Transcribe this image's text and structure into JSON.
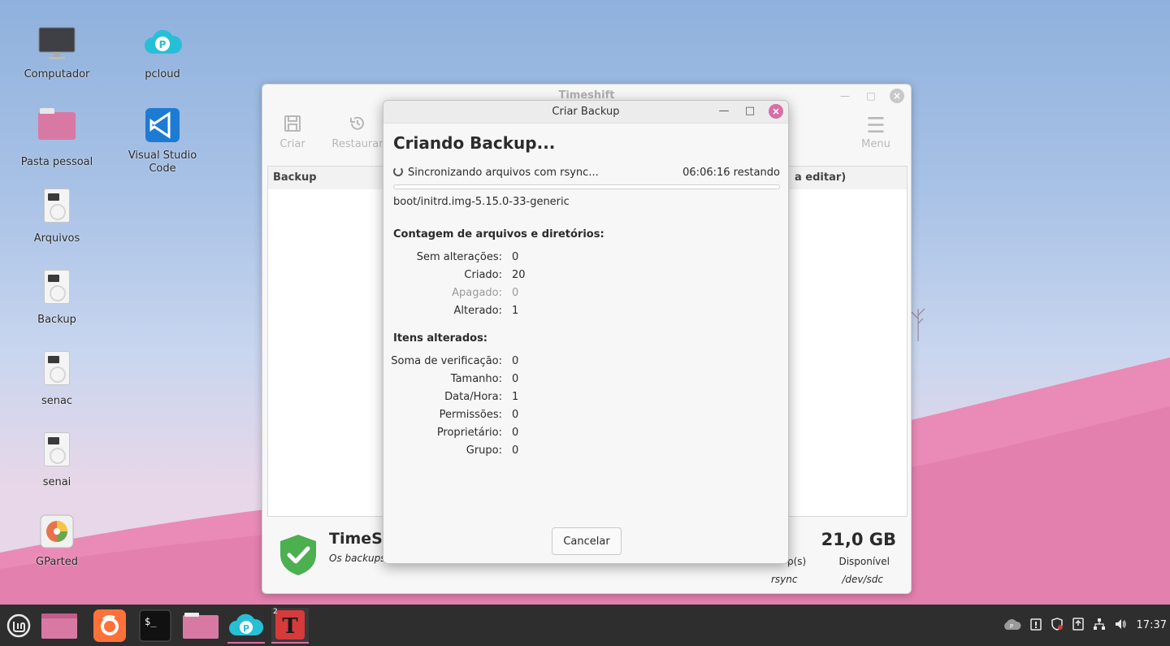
{
  "desktop": {
    "icons": [
      {
        "label": "Computador"
      },
      {
        "label": "pcloud"
      },
      {
        "label": "Pasta pessoal"
      },
      {
        "label": "Visual Studio Code"
      },
      {
        "label": "Arquivos"
      },
      {
        "label": "Backup"
      },
      {
        "label": "senac"
      },
      {
        "label": "senai"
      },
      {
        "label": "GParted"
      }
    ]
  },
  "timeshift": {
    "title": "Timeshift",
    "toolbar": {
      "create": "Criar",
      "restore": "Restaurar",
      "menu": "Menu"
    },
    "table": {
      "col_backup": "Backup",
      "col_comment": "a editar)"
    },
    "status": {
      "name": "TimeSh",
      "subtitle": "Os backups",
      "size": "21,0 GB",
      "available_label": "Disponível",
      "device": "/dev/sdc",
      "snapshots_label": "p(s)",
      "mode": "rsync"
    }
  },
  "dialog": {
    "title": "Criar Backup",
    "heading": "Criando Backup...",
    "status": "Sincronizando arquivos com rsync...",
    "remaining": "06:06:16 restando",
    "progress": 0.0,
    "current_file": "boot/initrd.img-5.15.0-33-generic",
    "section_counts": "Contagem de arquivos e diretórios:",
    "counts": [
      {
        "label": "Sem alterações:",
        "value": "0"
      },
      {
        "label": "Criado:",
        "value": "20"
      },
      {
        "label": "Apagado:",
        "value": "0"
      },
      {
        "label": "Alterado:",
        "value": "1"
      }
    ],
    "section_changed": "Itens alterados:",
    "changed": [
      {
        "label": "Soma de verificação:",
        "value": "0"
      },
      {
        "label": "Tamanho:",
        "value": "0"
      },
      {
        "label": "Data/Hora:",
        "value": "1"
      },
      {
        "label": "Permissões:",
        "value": "0"
      },
      {
        "label": "Proprietário:",
        "value": "0"
      },
      {
        "label": "Grupo:",
        "value": "0"
      }
    ],
    "cancel_label": "Cancelar"
  },
  "taskbar": {
    "workspace_badge": "2",
    "clock": "17:37",
    "accent": "#d66fa4"
  }
}
